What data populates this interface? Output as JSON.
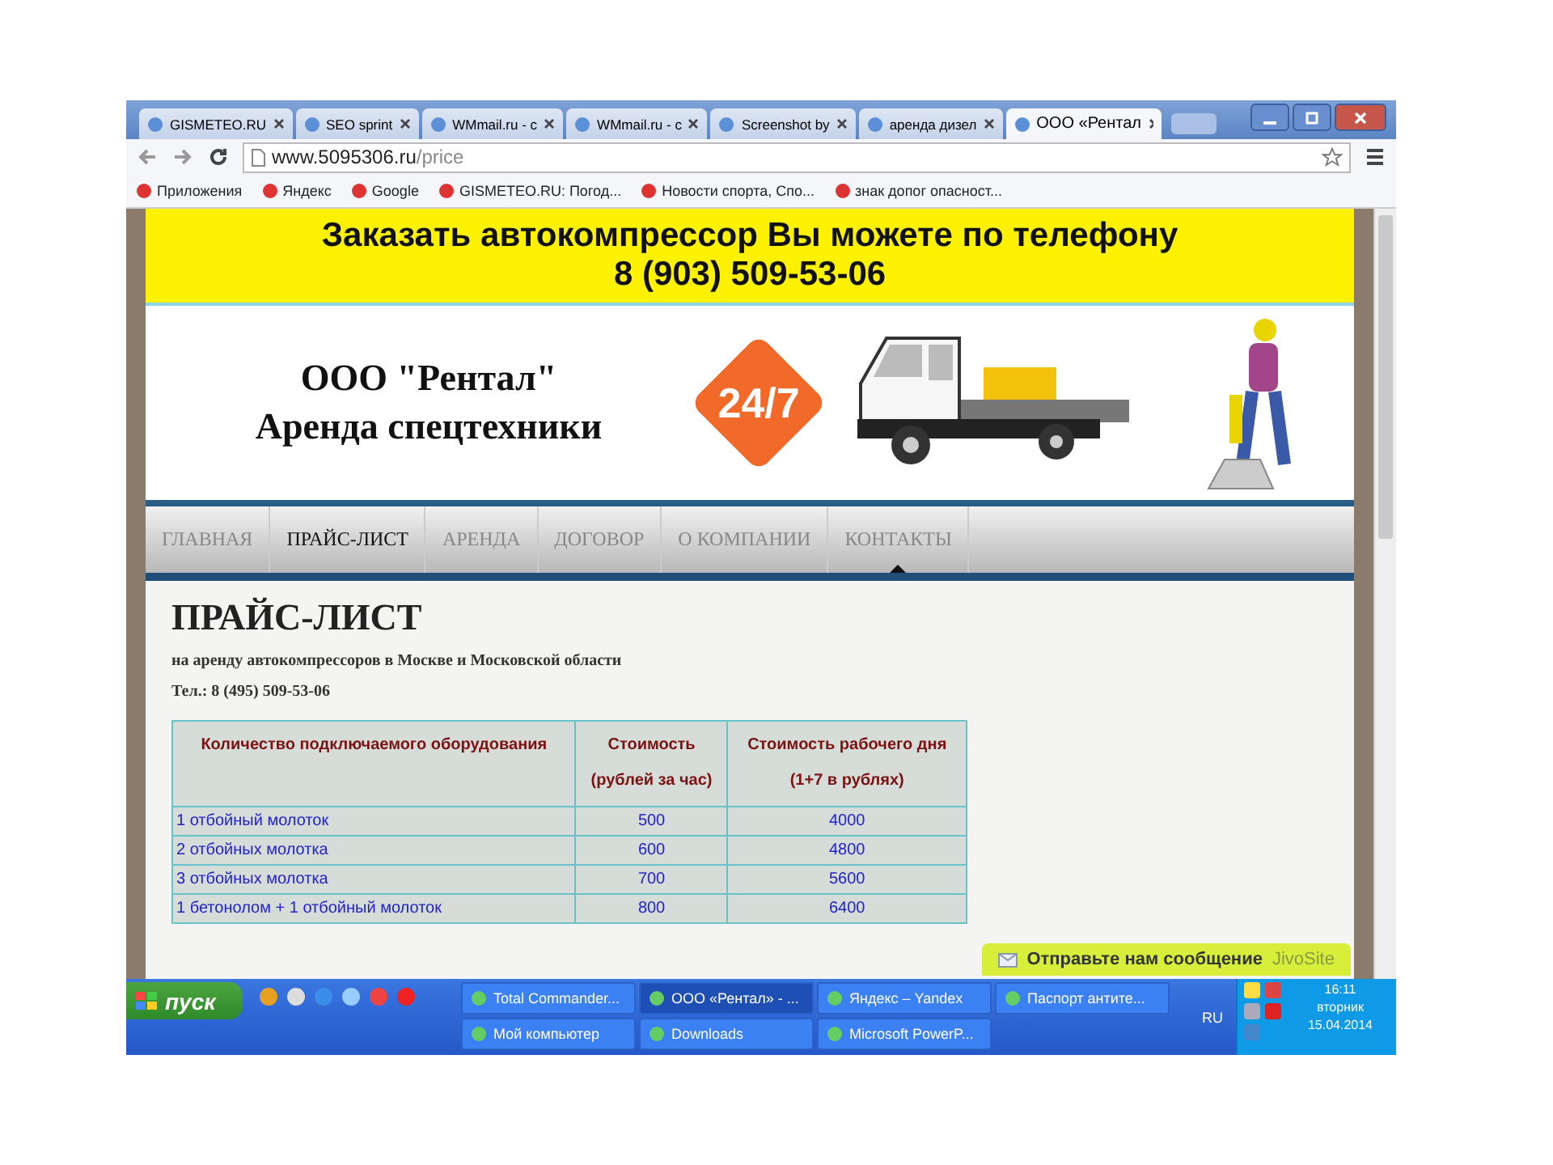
{
  "browser": {
    "tabs": [
      {
        "label": "GISMETEO.RU",
        "selected": false
      },
      {
        "label": "SEO sprint",
        "selected": false
      },
      {
        "label": "WMmail.ru - с",
        "selected": false
      },
      {
        "label": "WMmail.ru - с",
        "selected": false
      },
      {
        "label": "Screenshot by",
        "selected": false
      },
      {
        "label": "аренда дизел",
        "selected": false
      },
      {
        "label": "ООО «Рентал",
        "selected": true
      }
    ],
    "address": {
      "domain": "www.5095306.ru",
      "path": "/price"
    },
    "bookmarks": [
      "Приложения",
      "Яндекс",
      "Google",
      "GISMETEO.RU: Погод...",
      "Новости спорта, Спо...",
      "знак допог опасност..."
    ]
  },
  "site": {
    "banner": {
      "line1": "Заказать автокомпрессор Вы можете по телефону",
      "line2": "8 (903) 509-53-06"
    },
    "company": {
      "name": "ООО \"Рентал\"",
      "tagline": "Аренда спецтехники",
      "badge": "24/7"
    },
    "nav": [
      {
        "label": "ГЛАВНАЯ",
        "selected": false,
        "pointer": false
      },
      {
        "label": "ПРАЙС-ЛИСТ",
        "selected": true,
        "pointer": false
      },
      {
        "label": "АРЕНДА",
        "selected": false,
        "pointer": false
      },
      {
        "label": "ДОГОВОР",
        "selected": false,
        "pointer": false
      },
      {
        "label": "О КОМПАНИИ",
        "selected": false,
        "pointer": false
      },
      {
        "label": "КОНТАКТЫ",
        "selected": false,
        "pointer": true
      }
    ],
    "title": "ПРАЙС-ЛИСТ",
    "subtitle": "на аренду автокомпрессоров в Москве и Московской области",
    "phone": "Тел.: 8 (495) 509-53-06",
    "table": {
      "columns": [
        "Количество подключаемого оборудования",
        "Стоимость\n(рублей за час)",
        "Стоимость рабочего дня\n(1+7 в рублях)"
      ],
      "rows": [
        [
          "1 отбойный молоток",
          "500",
          "4000"
        ],
        [
          "2 отбойных молотка",
          "600",
          "4800"
        ],
        [
          "3 отбойных молотка",
          "700",
          "5600"
        ],
        [
          "1 бетонолом + 1 отбойный молоток",
          "800",
          "6400"
        ]
      ]
    },
    "chat": {
      "label": "Отправьте нам сообщение",
      "brand": "JivoSite"
    }
  },
  "taskbar": {
    "start": "пуск",
    "tasks": [
      {
        "label": "Total Commander...",
        "selected": false
      },
      {
        "label": "ООО «Рентал» - ...",
        "selected": true
      },
      {
        "label": "Яндекс – Yandex",
        "selected": false
      },
      {
        "label": "Паспорт антите...",
        "selected": false
      },
      {
        "label": "Мой компьютер",
        "selected": false
      },
      {
        "label": "Downloads",
        "selected": false
      },
      {
        "label": "Microsoft PowerP...",
        "selected": false
      }
    ],
    "language": "RU",
    "time": "16:11",
    "weekday": "вторник",
    "date": "15.04.2014"
  }
}
